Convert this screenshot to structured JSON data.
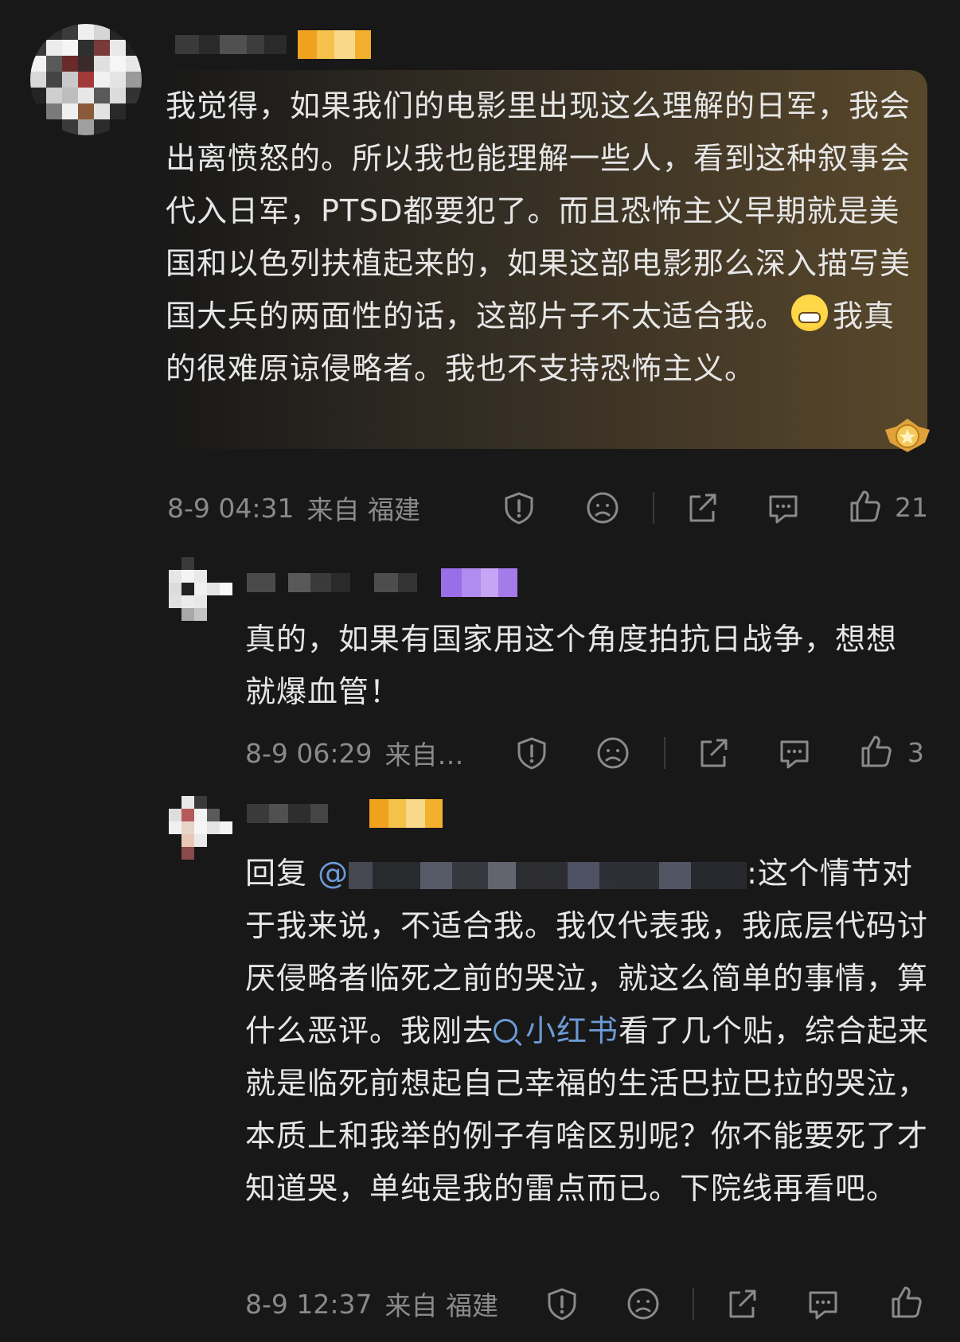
{
  "comments": [
    {
      "text_parts": {
        "before_emoji": "我觉得，如果我们的电影里出现这么理解的日军，我会出离愤怒的。所以我也能理解一些人，看到这种叙事会代入日军，PTSD都要犯了。而且恐怖主义早期就是美国和以色列扶植起来的，如果这部电影那么深入描写美国大兵的两面性的话，这部片子不太适合我。",
        "emoji": "grinning-face-emoji",
        "after_emoji": "我真的很难原谅侵略者。我也不支持恐怖主义。"
      },
      "time": "8-9 04:31",
      "location": "来自 福建",
      "likes": "21"
    },
    {
      "text": "真的，如果有国家用这个角度拍抗日战争，想想就爆血管！",
      "time": "8-9 06:29",
      "location": "来自…",
      "likes": "3"
    },
    {
      "reply_prefix": "回复",
      "mention": "@",
      "text_after_mention": ":这个情节对于我来说，不适合我。我仅代表我，我底层代码讨厌侵略者临死之前的哭泣，就这么简单的事情，算什么恶评。我刚去",
      "search_link": "小红书",
      "text_after_link": "看了几个贴，综合起来就是临死前想起自己幸福的生活巴拉巴拉的哭泣，本质上和我举的例子有啥区别呢？你不能要死了才知道哭，单纯是我的雷点而已。下院线再看吧。",
      "time": "8-9 12:37",
      "location": "来自 福建",
      "likes": ""
    }
  ],
  "colors": {
    "background": "#181818",
    "text": "#e6e6e6",
    "meta": "#8a8a8a",
    "link": "#6c9bd6"
  }
}
